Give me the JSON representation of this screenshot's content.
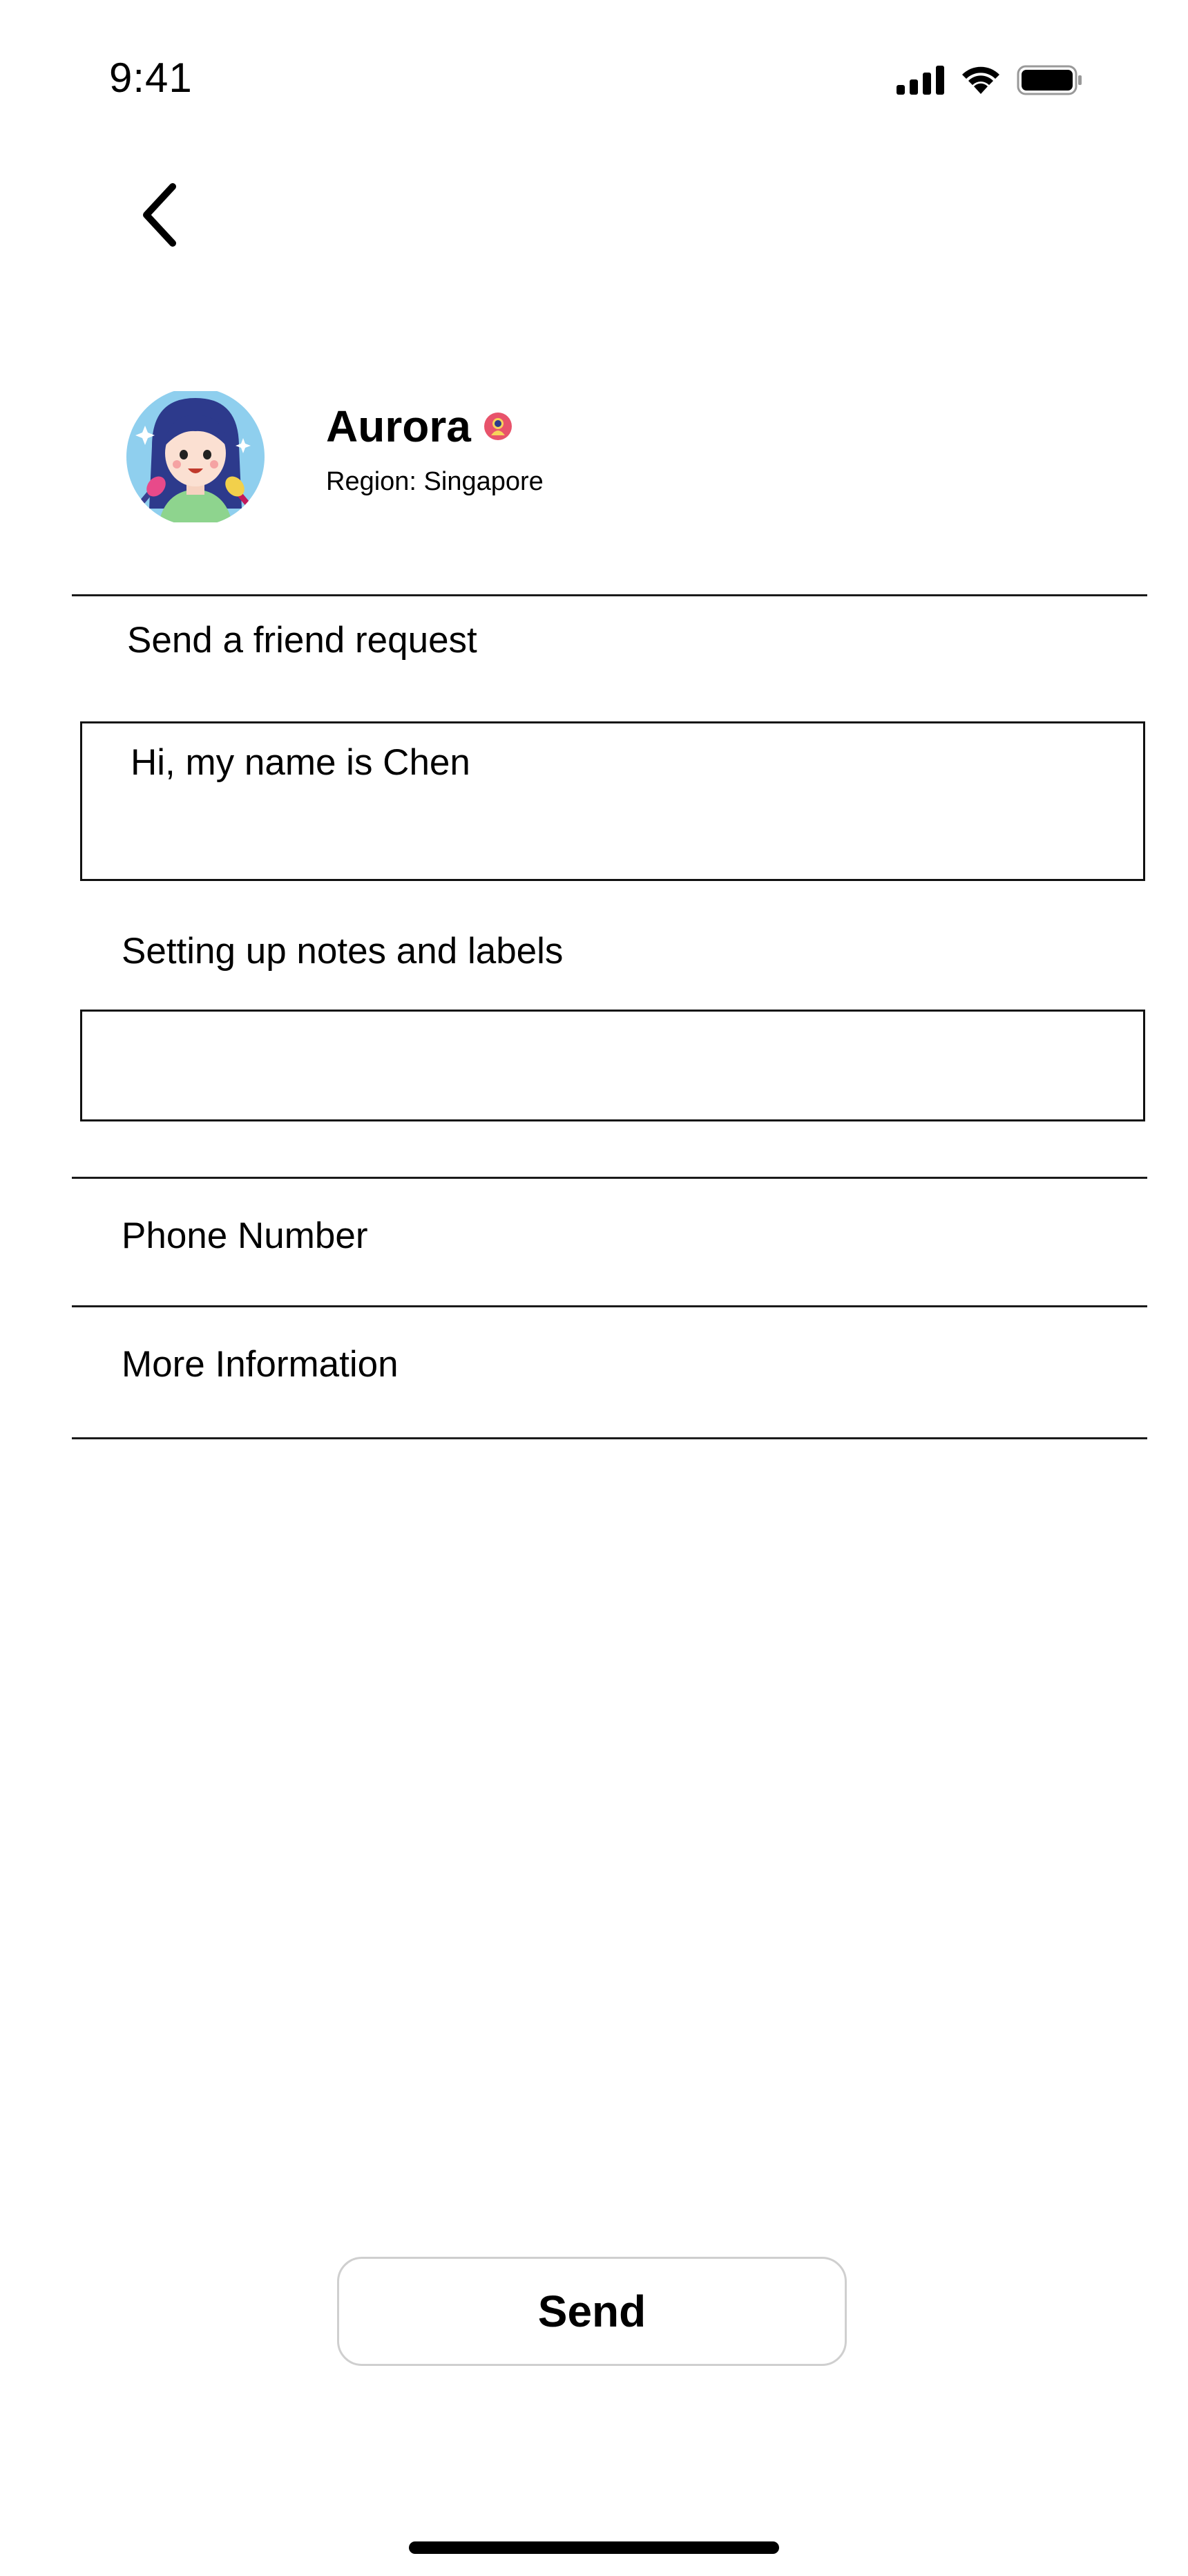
{
  "status_bar": {
    "time": "9:41"
  },
  "profile": {
    "name": "Aurora",
    "region": "Region: Singapore"
  },
  "friend_request": {
    "label": "Send a friend request",
    "message_value": "Hi, my name is Chen"
  },
  "notes": {
    "label": "Setting up notes and labels",
    "value": ""
  },
  "rows": {
    "phone": "Phone Number",
    "more_info": "More Information"
  },
  "actions": {
    "send_label": "Send"
  },
  "colors": {
    "avatar_bg": "#8fcfee",
    "hair": "#2d3a8c",
    "badge": "#e8536b",
    "divider": "#1a1a1a",
    "button_border": "#cfcfcf"
  }
}
